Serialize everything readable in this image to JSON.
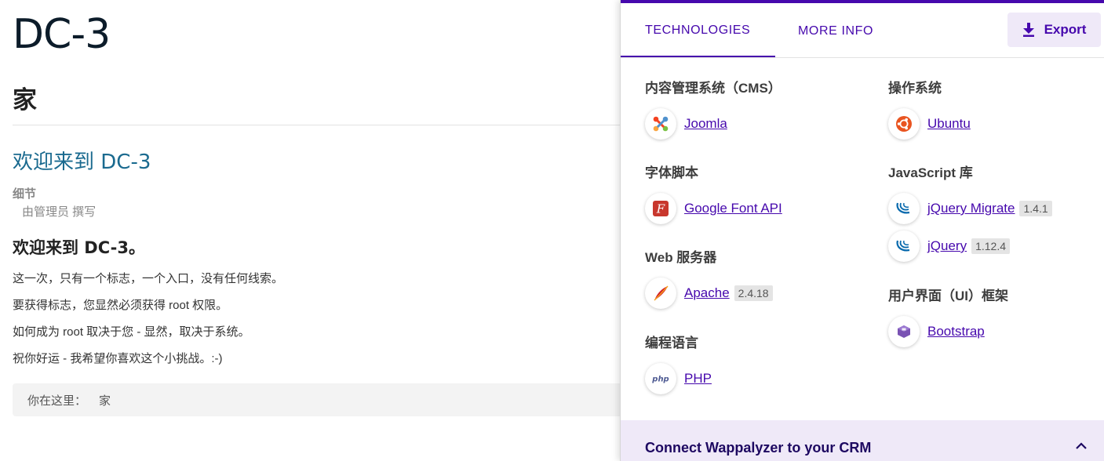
{
  "page": {
    "site_title": "DC-3",
    "nav_title": "家",
    "article_title": "欢迎来到 DC-3",
    "details_label": "细节",
    "details_author": "由管理员 撰写",
    "article_heading": "欢迎来到 DC-3。",
    "paragraphs": [
      "这一次，只有一个标志，一个入口，没有任何线索。",
      "要获得标志，您显然必须获得 root 权限。",
      "如何成为 root 取决于您 - 显然，取决于系统。",
      "祝你好运 - 我希望你喜欢这个小挑战。:-)"
    ],
    "breadcrumb": {
      "label": "你在这里：",
      "current": "家"
    }
  },
  "popup": {
    "tabs": [
      {
        "label": "TECHNOLOGIES"
      },
      {
        "label": "MORE INFO"
      }
    ],
    "export_label": "Export",
    "categories": [
      {
        "title": "内容管理系统（CMS）",
        "items": [
          {
            "name": "Joomla",
            "version": "",
            "icon": "joomla-icon"
          }
        ]
      },
      {
        "title": "字体脚本",
        "items": [
          {
            "name": "Google Font API",
            "version": "",
            "icon": "google-font-api-icon"
          }
        ]
      },
      {
        "title": "Web 服务器",
        "items": [
          {
            "name": "Apache",
            "version": "2.4.18",
            "icon": "apache-icon"
          }
        ]
      },
      {
        "title": "编程语言",
        "items": [
          {
            "name": "PHP",
            "version": "",
            "icon": "php-icon"
          }
        ]
      },
      {
        "title": "操作系统",
        "items": [
          {
            "name": "Ubuntu",
            "version": "",
            "icon": "ubuntu-icon"
          }
        ]
      },
      {
        "title": "JavaScript 库",
        "items": [
          {
            "name": "jQuery Migrate",
            "version": "1.4.1",
            "icon": "jquery-migrate-icon"
          },
          {
            "name": "jQuery",
            "version": "1.12.4",
            "icon": "jquery-icon"
          }
        ]
      },
      {
        "title": "用户界面（UI）框架",
        "items": [
          {
            "name": "Bootstrap",
            "version": "",
            "icon": "bootstrap-icon"
          }
        ]
      }
    ],
    "crm_text": "Connect Wappalyzer to your CRM",
    "colors": {
      "accent": "#4608ad",
      "accent_light": "#efe9f8",
      "link_title": "#1a6a8f"
    }
  }
}
